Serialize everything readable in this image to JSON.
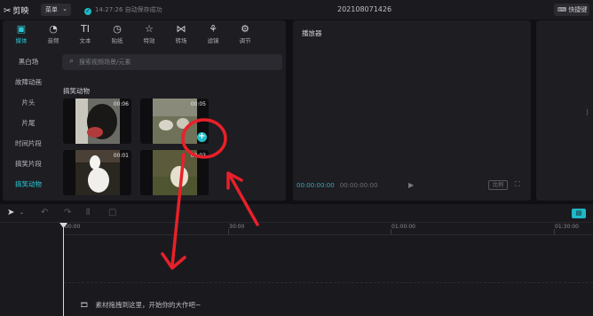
{
  "titlebar": {
    "app_name": "剪映",
    "menu_label": "菜单",
    "save_status": "14:27:26 自动保存成功",
    "project_name": "202108071426",
    "shortcut_label": "快捷键"
  },
  "toolbar": {
    "items": [
      {
        "label": "媒体",
        "icon": "media-icon"
      },
      {
        "label": "音频",
        "icon": "audio-icon"
      },
      {
        "label": "文本",
        "icon": "text-icon"
      },
      {
        "label": "贴纸",
        "icon": "sticker-icon"
      },
      {
        "label": "特效",
        "icon": "effects-icon"
      },
      {
        "label": "转场",
        "icon": "transition-icon"
      },
      {
        "label": "滤镜",
        "icon": "filter-icon"
      },
      {
        "label": "调节",
        "icon": "adjust-icon"
      }
    ],
    "active": "媒体"
  },
  "sidebar": {
    "items": [
      "黑白场",
      "故障动画",
      "片头",
      "片尾",
      "时间片段",
      "搞笑片段",
      "搞笑动物"
    ],
    "active": "搞笑动物"
  },
  "search": {
    "placeholder": "搜索视频场景/元素"
  },
  "library": {
    "section_title": "搞笑动物",
    "clips": [
      {
        "duration": "00:06",
        "subject": "black dog"
      },
      {
        "duration": "00:05",
        "subject": "goats"
      },
      {
        "duration": "00:01",
        "subject": "white bird"
      },
      {
        "duration": "00:03",
        "subject": "sheep"
      }
    ]
  },
  "player": {
    "title": "播放器",
    "current_time": "00:00:00:00",
    "total_time": "00:00:00:00",
    "ratio_label": "比例"
  },
  "timeline": {
    "ruler_labels": [
      "00:00",
      "30:00",
      "01:00:00",
      "01:30:00"
    ],
    "drop_hint": "素材拖拽到这里，开始你的大作吧~"
  },
  "colors": {
    "accent": "#23bfcc",
    "annotation": "#e8202a",
    "panel": "#1d1d22"
  }
}
